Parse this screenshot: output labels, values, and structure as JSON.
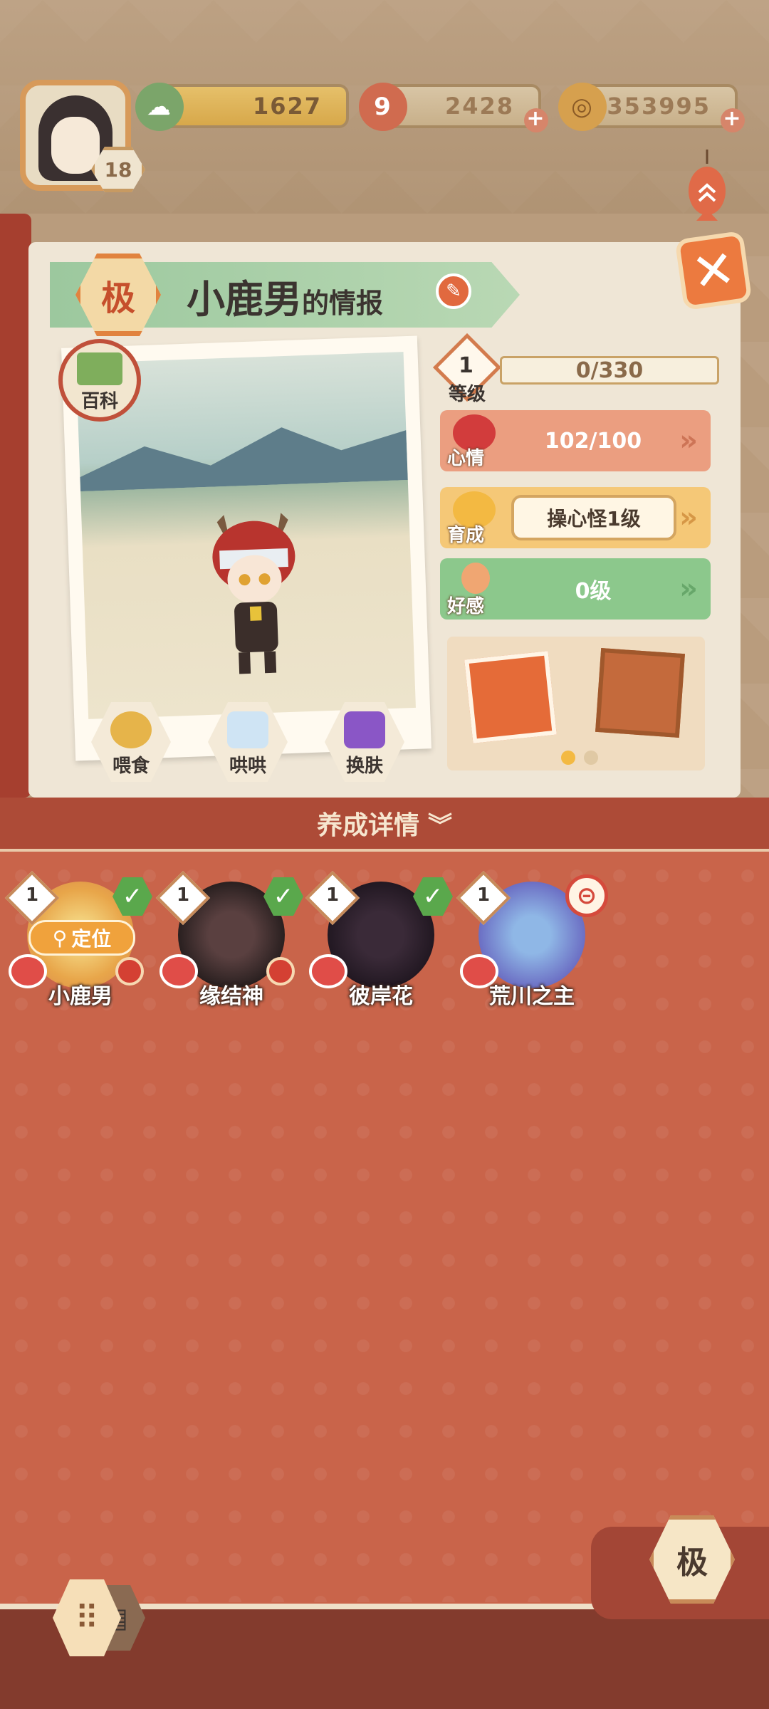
{
  "top_bar": {
    "player_level": "18",
    "currencies": [
      {
        "name": "jade",
        "value": "1627",
        "icon": "pine-cloud-icon"
      },
      {
        "name": "stamina",
        "value": "2428",
        "icon": "flame-icon"
      },
      {
        "name": "coins",
        "value": "353995",
        "icon": "coin-icon"
      }
    ]
  },
  "panel": {
    "rank_badge": "极",
    "title": "小鹿男",
    "title_suffix": "的情报",
    "wiki_label": "百科",
    "actions": [
      {
        "label": "喂食",
        "icon": "food-bowl-icon"
      },
      {
        "label": "哄哄",
        "icon": "milk-carton-icon"
      },
      {
        "label": "换肤",
        "icon": "gem-icon"
      }
    ],
    "stats": {
      "level": {
        "label": "等级",
        "number": "1",
        "value": "0/330"
      },
      "mood": {
        "label": "心情",
        "value": "102/100"
      },
      "training": {
        "label": "育成",
        "value": "操心怪1级"
      },
      "favor": {
        "label": "好感",
        "value": "0级"
      }
    },
    "items_page": 1,
    "items_page_count": 2
  },
  "detail_bar": {
    "label": "养成详情"
  },
  "roster": [
    {
      "name": "小鹿男",
      "level": "1",
      "status": "check",
      "locate_label": "定位"
    },
    {
      "name": "缘结神",
      "level": "1",
      "status": "check"
    },
    {
      "name": "彼岸花",
      "level": "1",
      "status": "check"
    },
    {
      "name": "荒川之主",
      "level": "1",
      "status": "locked"
    }
  ],
  "bottom": {
    "rank_filter": "极"
  },
  "colors": {
    "accent_red": "#c9644a",
    "mood_bar": "#eb9e80",
    "training_bar": "#f5c877",
    "favor_bar": "#8cc88c"
  }
}
